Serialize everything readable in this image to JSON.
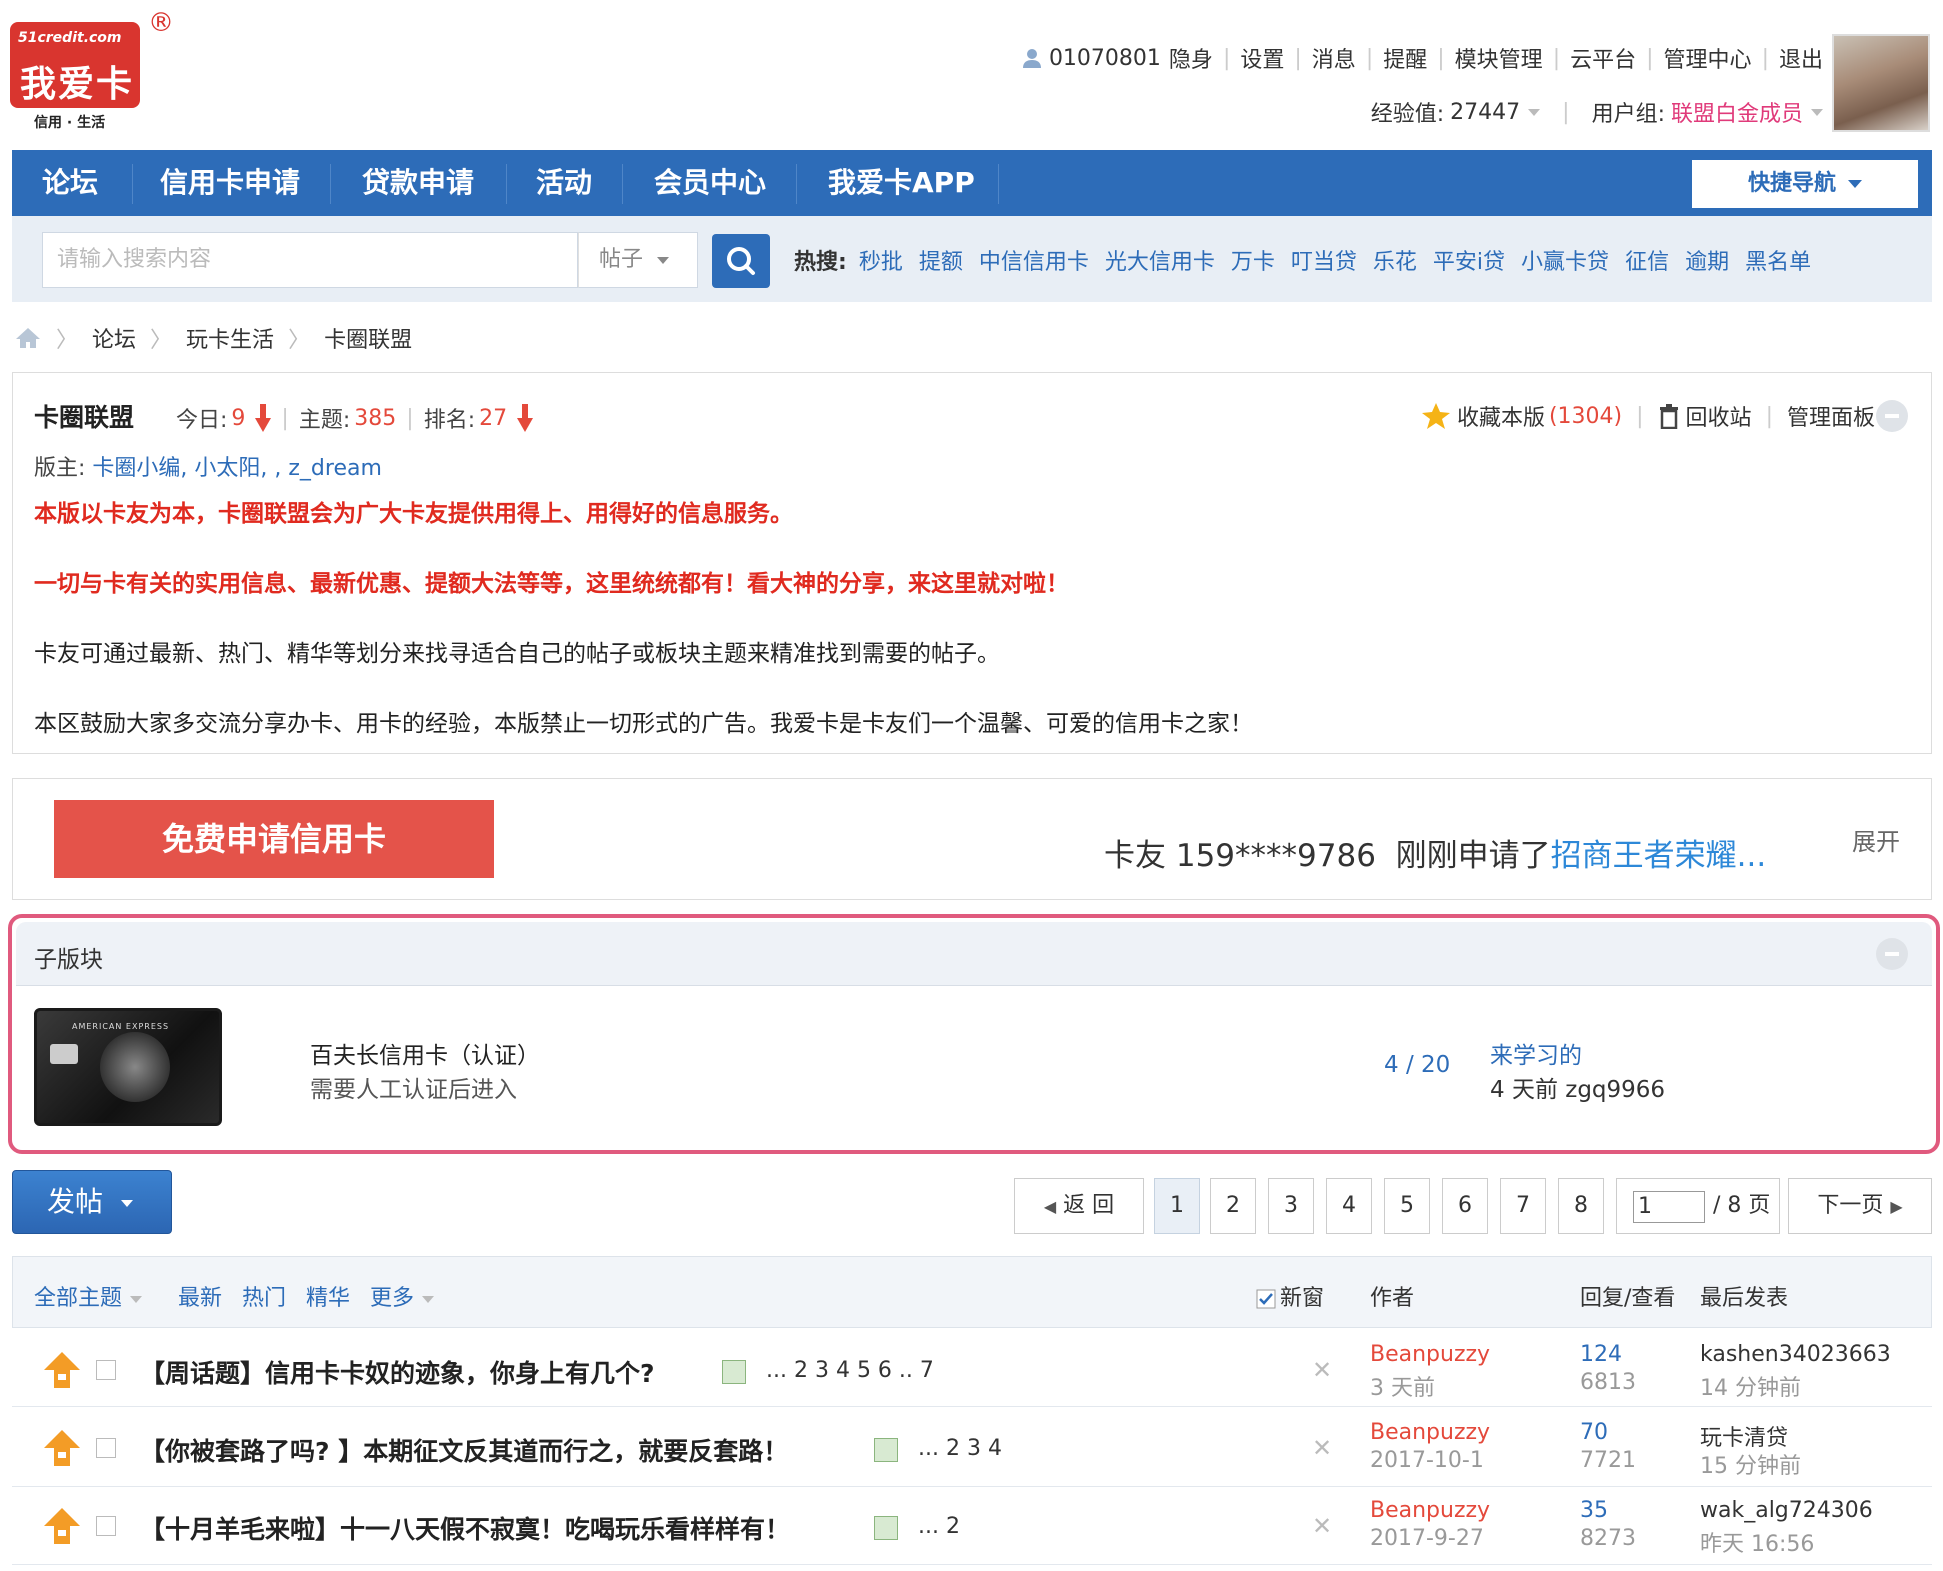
{
  "logo": {
    "top": "51credit.com",
    "main": "我爱卡",
    "reg": "®",
    "sub": "信用 · 生活"
  },
  "user": {
    "id": "01070801",
    "links": [
      "隐身",
      "设置",
      "消息",
      "提醒",
      "模块管理",
      "云平台",
      "管理中心",
      "退出"
    ],
    "exp_label": "经验值:",
    "exp_value": "27447",
    "group_label": "用户组:",
    "group_value": "联盟白金成员"
  },
  "nav": {
    "items": [
      "论坛",
      "信用卡申请",
      "贷款申请",
      "活动",
      "会员中心",
      "我爱卡APP"
    ],
    "quick": "快捷导航"
  },
  "search": {
    "placeholder": "请输入搜索内容",
    "type": "帖子",
    "hot_label": "热搜:",
    "hot": [
      "秒批",
      "提额",
      "中信信用卡",
      "光大信用卡",
      "万卡",
      "叮当贷",
      "乐花",
      "平安i贷",
      "小赢卡贷",
      "征信",
      "逾期",
      "黑名单"
    ]
  },
  "breadcrumb": [
    "论坛",
    "玩卡生活",
    "卡圈联盟"
  ],
  "forum": {
    "name": "卡圈联盟",
    "today_label": "今日:",
    "today": "9",
    "topics_label": "主题:",
    "topics": "385",
    "rank_label": "排名:",
    "rank": "27",
    "fav_label": "收藏本版",
    "fav_count": "(1304)",
    "recycle": "回收站",
    "admin": "管理面板",
    "mods_label": "版主:",
    "mods": "卡圈小编, 小太阳, , z_dream",
    "note1": "本版以卡友为本，卡圈联盟会为广大卡友提供用得上、用得好的信息服务。",
    "note2": "一切与卡有关的实用信息、最新优惠、提额大法等等，这里统统都有！看大神的分享，来这里就对啦！",
    "note3": "卡友可通过最新、热门、精华等划分来找寻适合自己的帖子或板块主题来精准找到需要的帖子。",
    "note4": "本区鼓励大家多交流分享办卡、用卡的经验，本版禁止一切形式的广告。我爱卡是卡友们一个温馨、可爱的信用卡之家！"
  },
  "apply": {
    "button": "免费申请信用卡",
    "text_prefix": "卡友 159****9786  刚刚申请了",
    "link": "招商王者荣耀...",
    "expand": "展开"
  },
  "subforum": {
    "title": "子版块",
    "card_text": "AMERICAN EXPRESS",
    "name": "百夫长信用卡（认证）",
    "desc": "需要人工认证后进入",
    "count": "4 / 20",
    "last_title": "来学习的",
    "last_info": "4 天前 zgq9966"
  },
  "toolbar": {
    "post": "发帖",
    "back": "返 回",
    "pages": [
      "1",
      "2",
      "3",
      "4",
      "5",
      "6",
      "7",
      "8"
    ],
    "current_page": "1",
    "total": "/ 8 页",
    "next": "下一页"
  },
  "list_header": {
    "all": "全部主题",
    "latest": "最新",
    "hot": "热门",
    "digest": "精华",
    "more": "更多",
    "newwin": "新窗",
    "author": "作者",
    "replies": "回复/查看",
    "last": "最后发表"
  },
  "threads": [
    {
      "title": "【周话题】信用卡卡奴的迹象，你身上有几个?",
      "pages": "... 2  3  4  5  6 .. 7",
      "author": "Beanpuzzy",
      "date": "3 天前",
      "replies": "124",
      "views": "6813",
      "last_user": "kashen34023663",
      "last_time": "14 分钟前"
    },
    {
      "title": "【你被套路了吗? 】本期征文反其道而行之，就要反套路！",
      "pages": "... 2  3  4",
      "author": "Beanpuzzy",
      "date": "2017-10-1",
      "replies": "70",
      "views": "7721",
      "last_user": "玩卡清贷",
      "last_time": "15 分钟前"
    },
    {
      "title": "【十月羊毛来啦】十一八天假不寂寞！吃喝玩乐看样样有！",
      "pages": "... 2",
      "author": "Beanpuzzy",
      "date": "2017-9-27",
      "replies": "35",
      "views": "8273",
      "last_user": "wak_alg724306",
      "last_time": "昨天 16:56"
    }
  ]
}
